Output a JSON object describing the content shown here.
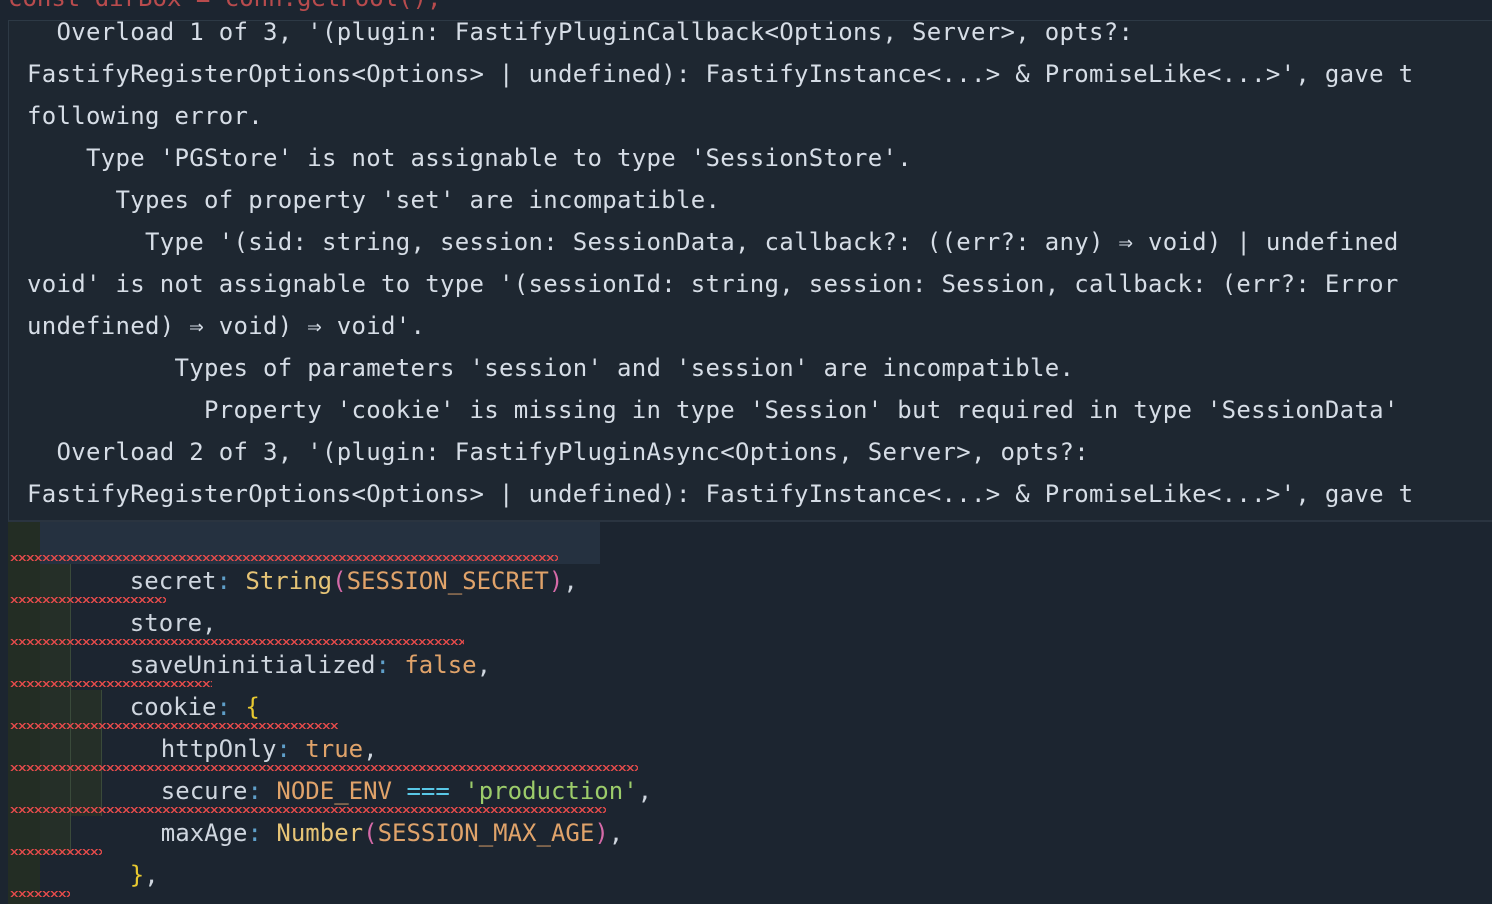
{
  "top_partial_line": "const dirBox = conn.getPool();",
  "hover": {
    "lines": [
      "  Overload 1 of 3, '(plugin: FastifyPluginCallback<Options, Server>, opts?:",
      "FastifyRegisterOptions<Options> | undefined): FastifyInstance<...> & PromiseLike<...>', gave t",
      "following error.",
      "    Type 'PGStore' is not assignable to type 'SessionStore'.",
      "      Types of property 'set' are incompatible.",
      "        Type '(sid: string, session: SessionData, callback?: ((err?: any) ⇒ void) | undefined",
      "void' is not assignable to type '(sessionId: string, session: Session, callback: (err?: Error",
      "undefined) ⇒ void) ⇒ void'.",
      "          Types of parameters 'session' and 'session' are incompatible.",
      "            Property 'cookie' is missing in type 'Session' but required in type 'SessionData'",
      "  Overload 2 of 3, '(plugin: FastifyPluginAsync<Options, Server>, opts?:",
      "FastifyRegisterOptions<Options> | undefined): FastifyInstance<...> & PromiseLike<...>', gave t"
    ]
  },
  "code": {
    "line1": {
      "prop": "secret",
      "colon": ":",
      "fn": "String",
      "open": "(",
      "arg": "SESSION_SECRET",
      "close": ")",
      "comma": ","
    },
    "line2": {
      "prop": "store",
      "comma": ","
    },
    "line3": {
      "prop": "saveUninitialized",
      "colon": ":",
      "value": "false",
      "comma": ","
    },
    "line4": {
      "prop": "cookie",
      "colon": ":",
      "brace": "{"
    },
    "line5": {
      "prop": "httpOnly",
      "colon": ":",
      "value": "true",
      "comma": ","
    },
    "line6": {
      "prop": "secure",
      "colon": ":",
      "ident": "NODE_ENV",
      "op": "===",
      "str": "'production'",
      "comma": ","
    },
    "line7": {
      "prop": "maxAge",
      "colon": ":",
      "fn": "Number",
      "open": "(",
      "arg": "SESSION_MAX_AGE",
      "close": ")",
      "comma": ","
    },
    "line8": {
      "brace": "}",
      "comma": ","
    },
    "line9": {
      "brace": "}",
      "paren": ")",
      "semi": ";"
    }
  },
  "colors": {
    "background": "#1c2530",
    "error_squiggle": "#e04a4a",
    "string": "#9ccc6a",
    "function": "#e6c476"
  }
}
